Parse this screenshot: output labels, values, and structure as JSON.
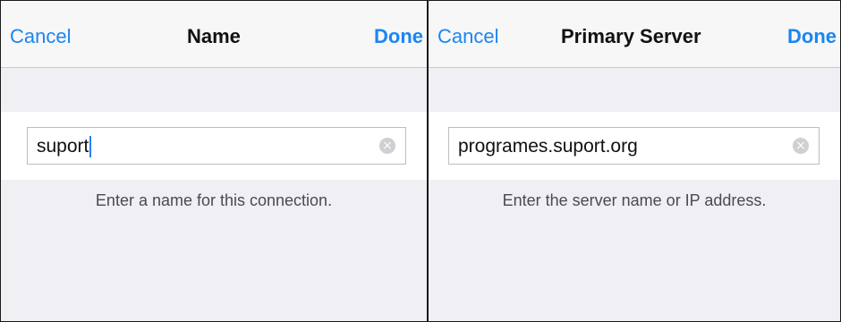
{
  "name_screen": {
    "navbar": {
      "cancel_label": "Cancel",
      "title": "Name",
      "done_label": "Done"
    },
    "field": {
      "value": "suport",
      "clear_icon": "clear-icon"
    },
    "hint": "Enter a name for this connection."
  },
  "server_screen": {
    "navbar": {
      "cancel_label": "Cancel",
      "title": "Primary Server",
      "done_label": "Done"
    },
    "field": {
      "value": "programes.suport.org",
      "clear_icon": "clear-icon"
    },
    "hint": "Enter the server name or IP address."
  },
  "colors": {
    "accent": "#1a86f0",
    "background": "#efeff4",
    "navbar": "#f7f7f8",
    "caret": "#2a7ff6"
  }
}
